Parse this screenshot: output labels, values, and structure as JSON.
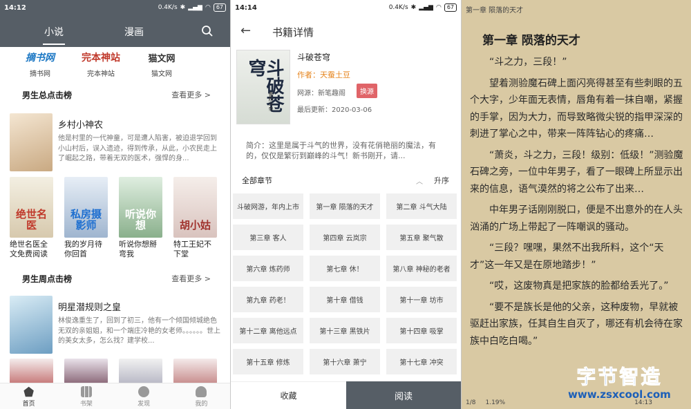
{
  "left": {
    "status": {
      "time": "14:12",
      "net": "0.4K/s",
      "battery": "67"
    },
    "tabs": [
      "小说",
      "漫画"
    ],
    "sources": [
      {
        "logo": "摘书网",
        "name": "摘书网",
        "color": "#1b77c4"
      },
      {
        "logo": "完本神站",
        "name": "完本神站",
        "color": "#c0392b"
      },
      {
        "logo": "猫文网",
        "name": "猫文网",
        "color": "#333333"
      }
    ],
    "section1": {
      "title": "男生总点击榜",
      "more": "查看更多 >"
    },
    "feature1": {
      "title": "乡村小神农",
      "desc": "他是村里的一代神童，可是遭人陷害，被迫退学回到小山村后，误入遗迹，得到传承，从此，小农民走上了崛起之路，带着无双的医术，强悍的身..."
    },
    "grid1": [
      "绝世名医全文免费阅读",
      "我的岁月待你回首",
      "听说你想掰弯我",
      "特工王妃不下堂"
    ],
    "covers1": [
      "绝世名医",
      "私房摄影师",
      "听说你想",
      "胡小姑"
    ],
    "section2": {
      "title": "男生周点击榜",
      "more": "查看更多 >"
    },
    "feature2": {
      "title": "明星潜规则之皇",
      "desc": "林俊逸重生了，回到了初三，他有一个倾国倾城绝色无双的亲姐姐，和一个端庄冷艳的女老师。。。。。。世上的美女太多，怎么找？建学校..."
    },
    "nav": [
      "首页",
      "书架",
      "发现",
      "我的"
    ]
  },
  "middle": {
    "status": {
      "time": "14:14",
      "net": "0.4K/s",
      "battery": "67"
    },
    "title": "书籍详情",
    "book": {
      "name": "斗破苍穹",
      "author": "作者：天蚕土豆",
      "source": "网源：新笔趣阁",
      "swap": "换源",
      "updated": "最后更新：2020-03-06",
      "cover_title": "斗破苍穹",
      "cover_sub": "曹阶斗帝",
      "intro": "简介：这里是属于斗气的世界，没有花俏艳丽的魔法，有的，仅仅是繁衍到巅峰的斗气！新书刚开，请..."
    },
    "chapters_title": "全部章节",
    "sort": "升序",
    "chapters": [
      "斗破网游，年内上市",
      "第一章 陨落的天才",
      "第二章 斗气大陆",
      "第三章 客人",
      "第四章 云岚宗",
      "第五章 聚气散",
      "第六章 炼药师",
      "第七章 休！",
      "第八章 神秘的老者",
      "第九章 药老！",
      "第十章 借钱",
      "第十一章 坊市",
      "第十二章 离他远点",
      "第十三章 黑铁片",
      "第十四章 吸掌",
      "第十五章 修炼",
      "第十六章 萧宁",
      "第十七章 冲突"
    ],
    "fav": "收藏",
    "read": "阅读"
  },
  "right": {
    "top": "第一章 陨落的天才",
    "title": "第一章 陨落的天才",
    "paragraphs": [
      "“斗之力，三段！”",
      "望着测验魔石碑上面闪亮得甚至有些刺眼的五个大字，少年面无表情，唇角有着一抹自嘲，紧握的手掌，因为大力，而导致略微尖锐的指甲深深的刺进了掌心之中，带来一阵阵钻心的疼痛…",
      "“萧炎，斗之力，三段！级别：低级！”测验魔石碑之旁，一位中年男子，看了一眼碑上所显示出来的信息，语气漠然的将之公布了出来…",
      "中年男子话刚刚脱口，便是不出意外的在人头汹涌的广场上带起了一阵嘲讽的骚动。",
      "“三段？嘿嘿，果然不出我所料，这个“天才”这一年又是在原地踏步！”",
      "“哎，这废物真是把家族的脸都给丢光了。”",
      "“要不是族长是他的父亲，这种废物，早就被驱赶出家族，任其自生自灭了，哪还有机会待在家族中白吃白喝。”"
    ],
    "page": "1/8",
    "percent": "1.19%",
    "time": "14:13"
  },
  "watermark": {
    "line1": "字节智造",
    "line2": "www.zsxcool.com"
  }
}
